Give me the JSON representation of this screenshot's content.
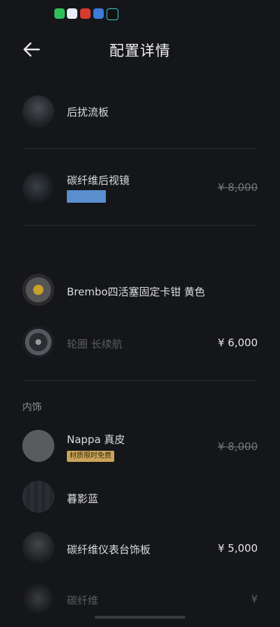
{
  "header": {
    "title": "配置详情"
  },
  "items": [
    {
      "label": "后扰流板",
      "price": ""
    },
    {
      "label": "碳纤维后视镜",
      "price": "¥ 8,000"
    },
    {
      "label": "Brembo四活塞固定卡钳 黄色",
      "price": ""
    },
    {
      "label": "轮圈 长续航",
      "price": "¥ 6,000"
    },
    {
      "label": "Nappa 真皮",
      "price": "¥ 8,000",
      "badge": "材质限时免费"
    },
    {
      "label": "暮影蓝",
      "price": ""
    },
    {
      "label": "碳纤维仪表台饰板",
      "price": "¥ 5,000"
    },
    {
      "label": "碳纤维",
      "price": "¥"
    }
  ],
  "sections": {
    "interior": "内饰"
  },
  "colors": {
    "background": "#15161a",
    "badge": "#c9a45a",
    "blue_tag": "#5a8fcf"
  }
}
